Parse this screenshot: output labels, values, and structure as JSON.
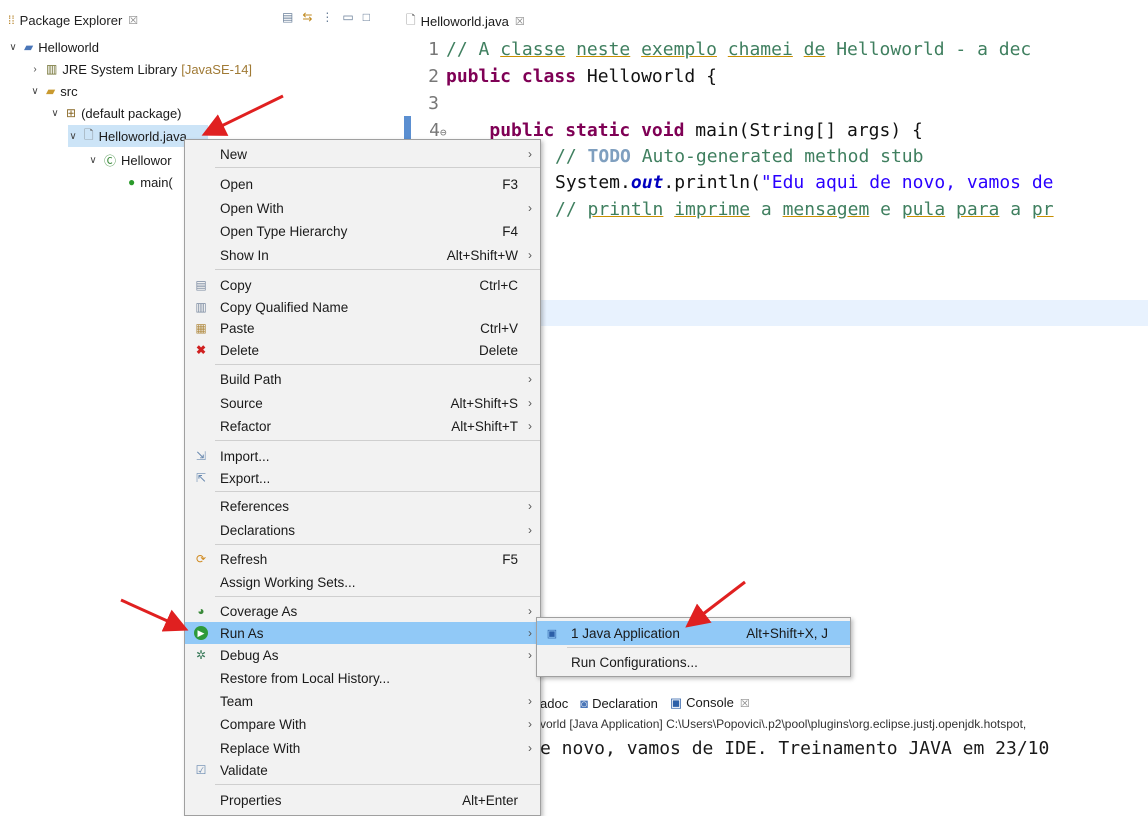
{
  "package_explorer": {
    "tab_label": "Package Explorer",
    "tab_close": "☒",
    "toolbar_icons": [
      "collapse-all-icon",
      "link-editor-icon",
      "view-menu-icon",
      "minimize-icon",
      "maximize-icon"
    ],
    "project": "Helloworld",
    "jre_label": "JRE System Library",
    "jre_decoration": "[JavaSE-14]",
    "src": "src",
    "package": "(default package)",
    "file": "Helloworld.java",
    "class_node": "Hellowor",
    "method_node": "main("
  },
  "editor": {
    "tab_label": "Helloworld.java",
    "tab_close": "☒",
    "lines": {
      "l1_num": "1",
      "l1_comment_a": "// A ",
      "l1_w1": "classe",
      "l1_s1": " ",
      "l1_w2": "neste",
      "l1_s2": " ",
      "l1_w3": "exemplo",
      "l1_s3": " ",
      "l1_w4": "chamei",
      "l1_s4": " ",
      "l1_w5": "de",
      "l1_rest": " Helloworld - a dec",
      "l2_num": "2",
      "l2_kw": "public class",
      "l2_rest": " Helloworld {",
      "l3_num": "3",
      "l4_num": "4",
      "l4_fold": "⊖",
      "l4_indent": "    ",
      "l4_kw": "public static void",
      "l4_rest": " main(String[] args) {",
      "l5_comment_a": "// ",
      "l5_todo": "TODO",
      "l5_comment_b": " Auto-generated method stub",
      "l6_a": "System.",
      "l6_out": "out",
      "l6_b": ".println(",
      "l6_str": "\"Edu aqui de novo, vamos de",
      "l7_comment_a": "// ",
      "l7_w1": "println",
      "l7_s1": " ",
      "l7_w2": "imprime",
      "l7_s2": " a ",
      "l7_w3": "mensagem",
      "l7_s3": " e ",
      "l7_w4": "pula",
      "l7_s4": " ",
      "l7_w5": "para",
      "l7_s5": " a ",
      "l7_w6": "pr"
    }
  },
  "console": {
    "tab_javadoc": "adoc",
    "tab_declaration": "Declaration",
    "tab_console": "Console",
    "tab_close": "☒",
    "path": "vorld [Java Application] C:\\Users\\Popovici\\.p2\\pool\\plugins\\org.eclipse.justj.openjdk.hotspot,",
    "output": "e novo, vamos de IDE. Treinamento JAVA em 23/10"
  },
  "context_menu": {
    "items": [
      {
        "label": "New",
        "shortcut": "",
        "arrow": "›"
      },
      {
        "label": "Open",
        "shortcut": "F3",
        "arrow": ""
      },
      {
        "label": "Open With",
        "shortcut": "",
        "arrow": "›"
      },
      {
        "label": "Open Type Hierarchy",
        "shortcut": "F4",
        "arrow": ""
      },
      {
        "label": "Show In",
        "shortcut": "Alt+Shift+W",
        "arrow": "›"
      },
      {
        "label": "Copy",
        "shortcut": "Ctrl+C",
        "arrow": ""
      },
      {
        "label": "Copy Qualified Name",
        "shortcut": "",
        "arrow": ""
      },
      {
        "label": "Paste",
        "shortcut": "Ctrl+V",
        "arrow": ""
      },
      {
        "label": "Delete",
        "shortcut": "Delete",
        "arrow": ""
      },
      {
        "label": "Build Path",
        "shortcut": "",
        "arrow": "›"
      },
      {
        "label": "Source",
        "shortcut": "Alt+Shift+S",
        "arrow": "›"
      },
      {
        "label": "Refactor",
        "shortcut": "Alt+Shift+T",
        "arrow": "›"
      },
      {
        "label": "Import...",
        "shortcut": "",
        "arrow": ""
      },
      {
        "label": "Export...",
        "shortcut": "",
        "arrow": ""
      },
      {
        "label": "References",
        "shortcut": "",
        "arrow": "›"
      },
      {
        "label": "Declarations",
        "shortcut": "",
        "arrow": "›"
      },
      {
        "label": "Refresh",
        "shortcut": "F5",
        "arrow": ""
      },
      {
        "label": "Assign Working Sets...",
        "shortcut": "",
        "arrow": ""
      },
      {
        "label": "Coverage As",
        "shortcut": "",
        "arrow": "›"
      },
      {
        "label": "Run As",
        "shortcut": "",
        "arrow": "›"
      },
      {
        "label": "Debug As",
        "shortcut": "",
        "arrow": "›"
      },
      {
        "label": "Restore from Local History...",
        "shortcut": "",
        "arrow": ""
      },
      {
        "label": "Team",
        "shortcut": "",
        "arrow": "›"
      },
      {
        "label": "Compare With",
        "shortcut": "",
        "arrow": "›"
      },
      {
        "label": "Replace With",
        "shortcut": "",
        "arrow": "›"
      },
      {
        "label": "Validate",
        "shortcut": "",
        "arrow": ""
      },
      {
        "label": "Properties",
        "shortcut": "Alt+Enter",
        "arrow": ""
      }
    ]
  },
  "submenu": {
    "items": [
      {
        "label": "1 Java Application",
        "shortcut": "Alt+Shift+X, J"
      },
      {
        "label": "Run Configurations...",
        "shortcut": ""
      }
    ]
  },
  "colors": {
    "highlight": "#91c9f7",
    "selection": "#cce4f7",
    "annotation_arrow": "#e02020",
    "keyword": "#7f0055",
    "comment": "#3f7f5f",
    "string": "#2a00ff"
  }
}
